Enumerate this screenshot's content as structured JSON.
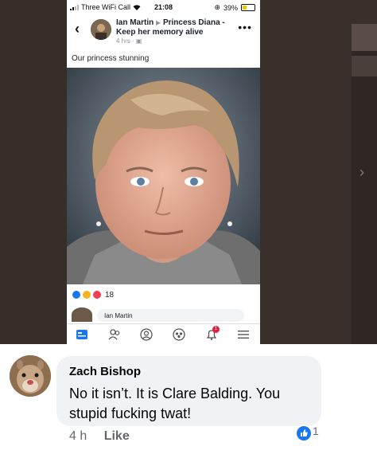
{
  "status_bar": {
    "carrier": "Three WiFi Call",
    "time": "21:08",
    "battery": "39%"
  },
  "post": {
    "author": "Ian Martin",
    "arrow": "▶",
    "group": "Princess Diana - Keep her memory alive",
    "time": "4 hrs",
    "caption": "Our princess stunning",
    "reaction_count": "18",
    "comment_preview_name": "Ian Martin"
  },
  "tabbar": {
    "notification_count": "1"
  },
  "comment": {
    "author": "Zach Bishop",
    "text": "No it isn’t. It is Clare Balding. You stupid fucking twat!",
    "time": "4 h",
    "like_label": "Like",
    "like_count": "1"
  },
  "colors": {
    "facebook_blue": "#1877f2",
    "notification_red": "#e41e3f",
    "bubble_grey": "#f0f2f5"
  }
}
